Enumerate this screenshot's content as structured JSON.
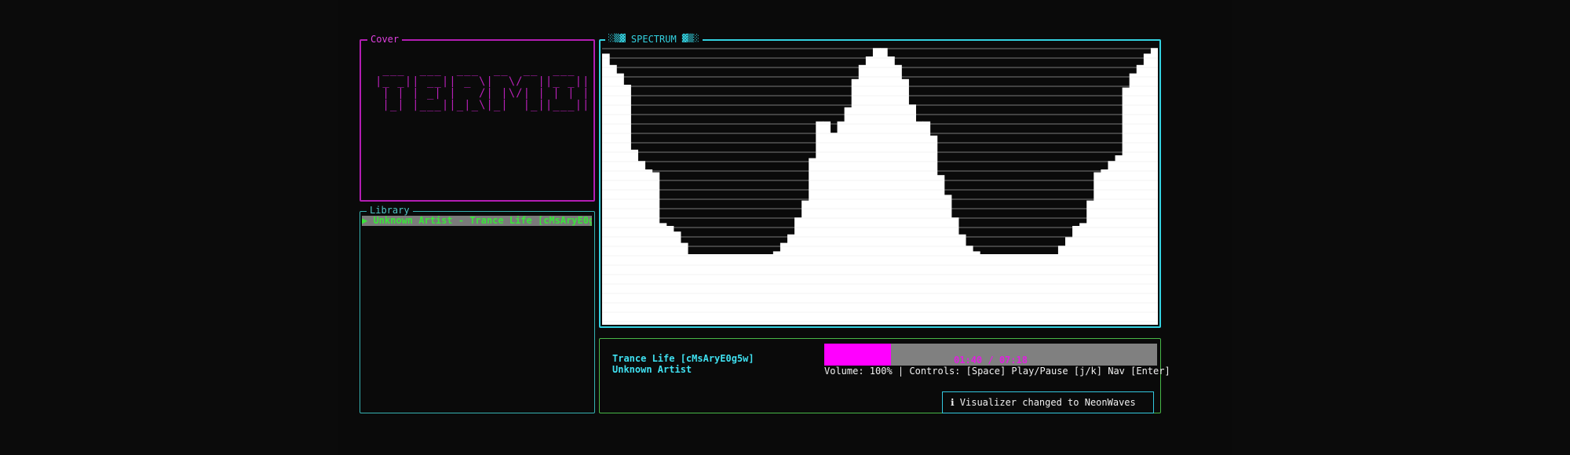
{
  "colors": {
    "cover_border": "#b31db3",
    "library_border": "#36b3b3",
    "spectrum_border": "#33d1e0",
    "player_border": "#48b848",
    "progress_fill": "#ff00ff",
    "progress_track": "#808080",
    "bar_color": "#ffffff"
  },
  "cover": {
    "title": " Cover",
    "art_lines": [
      " ___  ___  ___  __  __  ___  _  _  ___ ",
      "|_ _|| __|| _ \\|  \\/  ||_ _|| \\| |/   \\",
      " | | | _| |   /| |\\/| | | | | .` || - |",
      " |_| |___||_|_\\|_|  |_||___||_|\\_||_|_|"
    ]
  },
  "library": {
    "title": " Library",
    "items": [
      "▶ Unknown Artist - Trance Life [cMsAryE0g"
    ]
  },
  "spectrum": {
    "title": "░▒▓ SPECTRUM ▓▒░",
    "levels": [
      0.96,
      0.92,
      0.89,
      0.85,
      0.62,
      0.58,
      0.55,
      0.54,
      0.36,
      0.35,
      0.33,
      0.29,
      0.25,
      0.25,
      0.25,
      0.25,
      0.25,
      0.25,
      0.25,
      0.25,
      0.25,
      0.25,
      0.25,
      0.25,
      0.26,
      0.29,
      0.32,
      0.38,
      0.44,
      0.59,
      0.72,
      0.72,
      0.68,
      0.72,
      0.77,
      0.87,
      0.92,
      0.95,
      0.98,
      0.98,
      0.95,
      0.92,
      0.87,
      0.78,
      0.72,
      0.72,
      0.67,
      0.53,
      0.46,
      0.38,
      0.32,
      0.28,
      0.26,
      0.25,
      0.25,
      0.25,
      0.25,
      0.25,
      0.25,
      0.25,
      0.25,
      0.25,
      0.25,
      0.25,
      0.28,
      0.31,
      0.35,
      0.36,
      0.44,
      0.54,
      0.55,
      0.58,
      0.6,
      0.84,
      0.89,
      0.92,
      0.96,
      0.98
    ]
  },
  "player": {
    "track_title": " Trance Life [cMsAryE0g5w]",
    "artist": " Unknown Artist",
    "progress": 0.2,
    "time": "01:40 / 07:18",
    "status": "Volume: 100% | Controls: [Space] Play/Pause [j/k] Nav [Enter]"
  },
  "toast": {
    "message": "ℹ Visualizer changed to NeonWaves"
  }
}
